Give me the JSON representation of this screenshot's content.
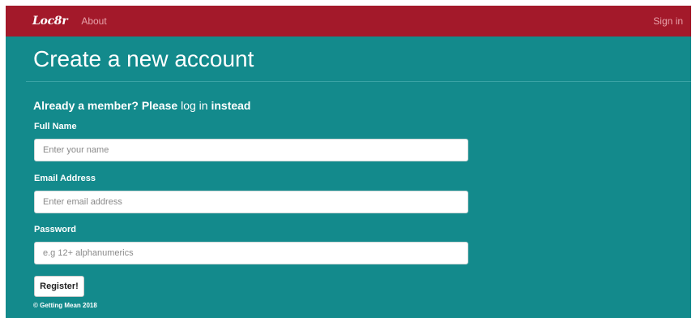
{
  "navbar": {
    "brand": "Loc8r",
    "about_label": "About",
    "signin_label": "Sign in"
  },
  "page": {
    "title": "Create a new account"
  },
  "lead": {
    "prefix": "Already a member? Please ",
    "login_link": "log in",
    "suffix": " instead"
  },
  "form": {
    "name": {
      "label": "Full Name",
      "placeholder": "Enter your name",
      "value": ""
    },
    "email": {
      "label": "Email Address",
      "placeholder": "Enter email address",
      "value": ""
    },
    "password": {
      "label": "Password",
      "placeholder": "e.g 12+ alphanumerics",
      "value": ""
    },
    "submit_label": "Register!"
  },
  "footer": {
    "text": "© Getting Mean 2018"
  },
  "colors": {
    "navbar_bg": "#a3192a",
    "page_bg": "#138a8c",
    "nav_link": "#e8a3ab"
  }
}
